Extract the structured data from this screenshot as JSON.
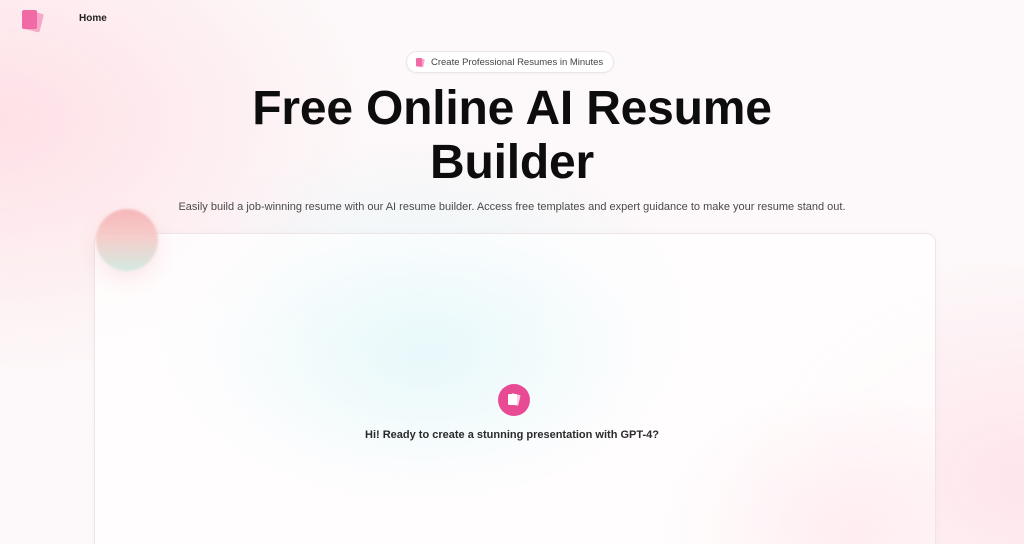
{
  "nav": {
    "home_label": "Home",
    "logo_icon": "pink-pages-logo-icon"
  },
  "hero": {
    "badge_text": "Create Professional Resumes in Minutes",
    "badge_icon": "pink-pages-icon",
    "title": "Free Online AI Resume Builder",
    "subtitle": "Easily build a job-winning resume with our AI resume builder. Access free templates and expert guidance to make your resume stand out."
  },
  "chat": {
    "avatar_icon": "pink-pages-icon",
    "greeting": "Hi! Ready to create a stunning presentation with GPT-4?"
  },
  "colors": {
    "accent": "#e84a93",
    "logo_pink": "#f06aa6",
    "background": "#fdf8f9"
  }
}
